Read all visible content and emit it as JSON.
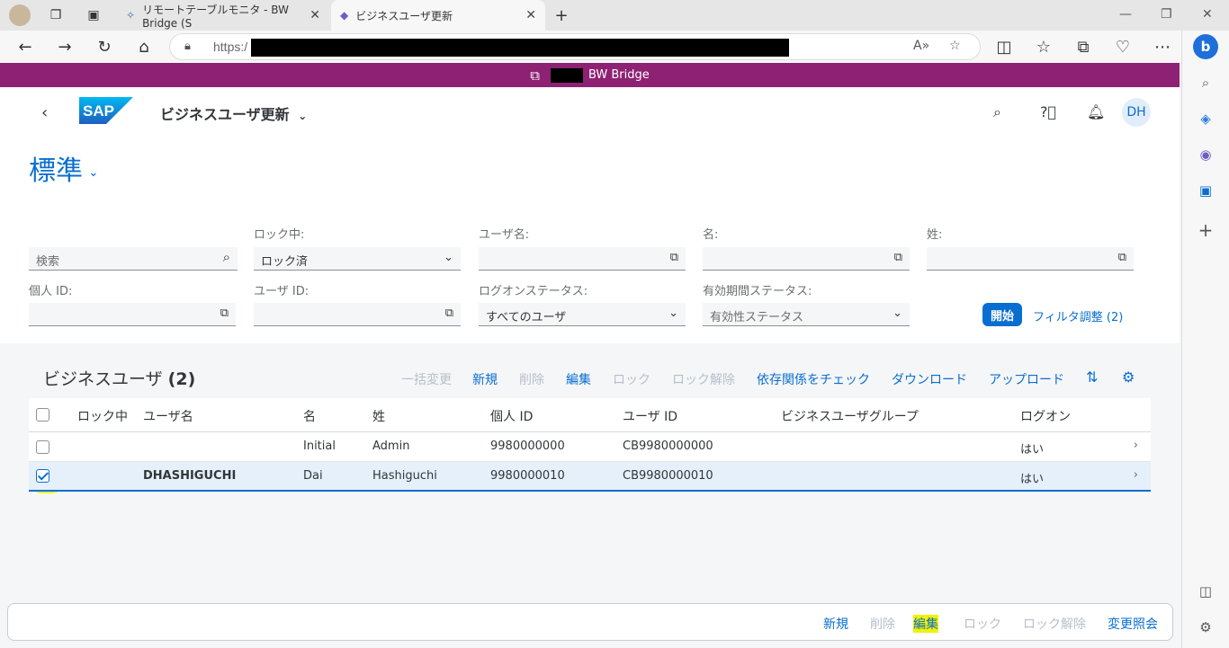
{
  "browser": {
    "tabs": [
      {
        "label": "リモートテーブルモニタ - BW Bridge (S"
      },
      {
        "label": "ビジネスユーザ更新"
      }
    ],
    "url_prefix": "https:/",
    "new_tab": "+"
  },
  "shell": {
    "system_name": "BW Bridge"
  },
  "header": {
    "app_title": "ビジネスユーザ更新",
    "avatar_initials": "DH"
  },
  "variant": {
    "name": "標準"
  },
  "filters": {
    "search_placeholder": "検索",
    "locked_label": "ロック中:",
    "locked_value": "ロック済",
    "username_label": "ユーザ名:",
    "firstname_label": "名:",
    "lastname_label": "姓:",
    "person_id_label": "個人 ID:",
    "user_id_label": "ユーザ ID:",
    "logon_status_label": "ログオンステータス:",
    "logon_status_value": "すべてのユーザ",
    "validity_label": "有効期間ステータス:",
    "validity_value": "有効性ステータス",
    "go_button": "開始",
    "adapt_filters": "フィルタ調整 (2)"
  },
  "table": {
    "title": "ビジネスユーザ",
    "count": "(2)",
    "toolbar": {
      "mass_change": "一括変更",
      "new": "新規",
      "delete": "削除",
      "edit": "編集",
      "lock": "ロック",
      "unlock": "ロック解除",
      "check_dependencies": "依存関係をチェック",
      "download": "ダウンロード",
      "upload": "アップロード"
    },
    "columns": [
      "ロック中",
      "ユーザ名",
      "名",
      "姓",
      "個人 ID",
      "ユーザ ID",
      "ビジネスユーザグループ",
      "ログオン"
    ],
    "rows": [
      {
        "locked": "",
        "username": "",
        "first": "Initial",
        "last": "Admin",
        "person_id": "9980000000",
        "user_id": "CB9980000000",
        "group": "",
        "logon": "はい",
        "selected": false
      },
      {
        "locked": "",
        "username": "DHASHIGUCHI",
        "first": "Dai",
        "last": "Hashiguchi",
        "person_id": "9980000010",
        "user_id": "CB9980000010",
        "group": "",
        "logon": "はい",
        "selected": true
      }
    ]
  },
  "footer": {
    "new": "新規",
    "delete": "削除",
    "edit": "編集",
    "lock": "ロック",
    "unlock": "ロック解除",
    "change_docs": "変更照会"
  },
  "colors": {
    "shell_bar": "#8e2173",
    "accent": "#0a6ed1",
    "highlight": "#f2f200"
  }
}
